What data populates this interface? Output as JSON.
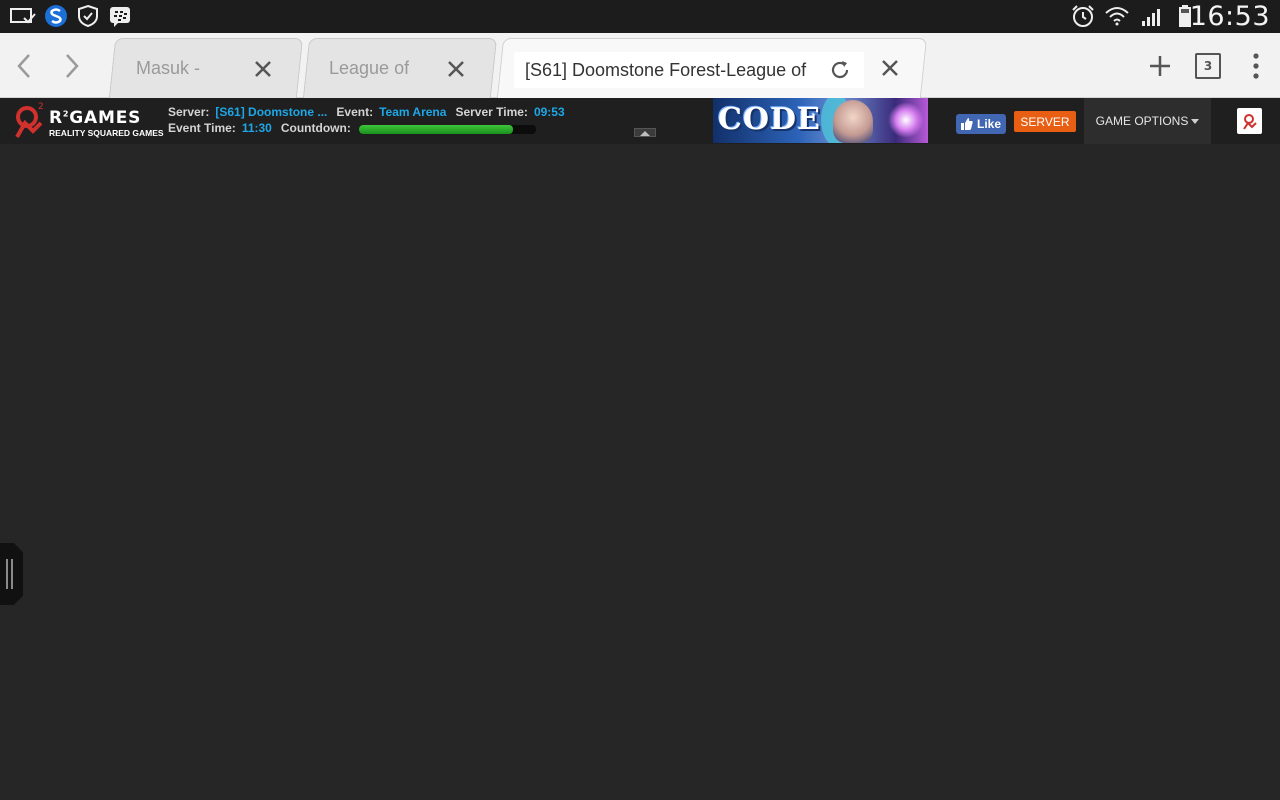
{
  "status_bar": {
    "time": "16:53",
    "left_icons": [
      "screen-mirror-icon",
      "s-app-icon",
      "shield-check-icon",
      "bbm-icon"
    ],
    "right_icons": [
      "alarm-icon",
      "wifi-icon",
      "signal-icon",
      "battery-icon"
    ]
  },
  "browser": {
    "tabs": [
      {
        "title": "Masuk -",
        "active": false
      },
      {
        "title": "League of",
        "active": false
      },
      {
        "title": "[S61] Doomstone Forest-League of",
        "active": true
      }
    ],
    "tab_count": "3"
  },
  "game_header": {
    "logo_name": "R",
    "logo_sup": "2",
    "logo_name_rest": "GAMES",
    "logo_sup_top": "2",
    "logo_sub": "REALITY SQUARED GAMES",
    "server_label": "Server:",
    "server_value": "[S61] Doomstone ...",
    "event_label": "Event:",
    "event_value": "Team Arena",
    "server_time_label": "Server Time:",
    "server_time_value": "09:53",
    "event_time_label": "Event Time:",
    "event_time_value": "11:30",
    "countdown_label": "Countdown:",
    "countdown_progress": 0.87,
    "banner_text": "CODE",
    "like_label": "Like",
    "server_button": "SERVER",
    "game_options": "GAME OPTIONS",
    "accent_color": "#1ea7e6",
    "server_button_color": "#e85e12"
  }
}
